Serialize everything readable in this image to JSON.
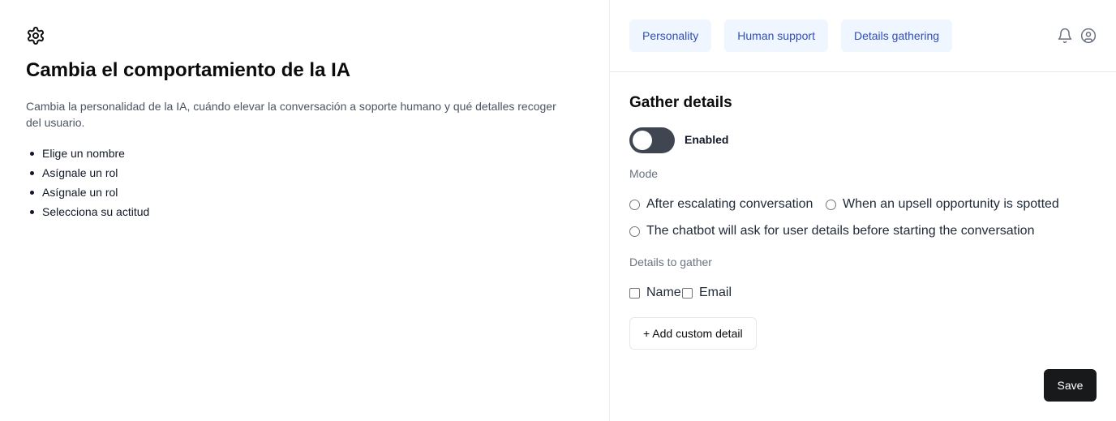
{
  "info_panel": {
    "icon": "gear-icon",
    "title": "Cambia el comportamiento de la IA",
    "description": "Cambia la personalidad de la IA, cuándo elevar la conversación a soporte humano y qué detalles recoger del usuario.",
    "bullets": [
      "Elige un nombre",
      "Asígnale un rol",
      "Asígnale un rol",
      "Selecciona su actitud"
    ]
  },
  "header": {
    "tabs": [
      {
        "label": "Personality"
      },
      {
        "label": "Human support"
      },
      {
        "label": "Details gathering"
      }
    ],
    "icons": [
      "bell-icon",
      "user-circle-icon"
    ]
  },
  "gather": {
    "title": "Gather details",
    "toggle": {
      "label": "Enabled",
      "on": false
    },
    "mode_label": "Mode",
    "modes": [
      {
        "label": "After escalating conversation",
        "selected": false
      },
      {
        "label": "When an upsell opportunity is spotted",
        "selected": false
      },
      {
        "label": "The chatbot will ask for user details before starting the conversation",
        "selected": false
      }
    ],
    "details_label": "Details to gather",
    "details": [
      {
        "label": "Name",
        "checked": false
      },
      {
        "label": "Email",
        "checked": false
      }
    ],
    "add_label": "+ Add custom detail",
    "save_label": "Save"
  },
  "colors": {
    "tab_bg": "#eff6ff",
    "tab_text": "#2f4fb5",
    "toggle_track": "#3f4652",
    "save_bg": "#18191b"
  }
}
